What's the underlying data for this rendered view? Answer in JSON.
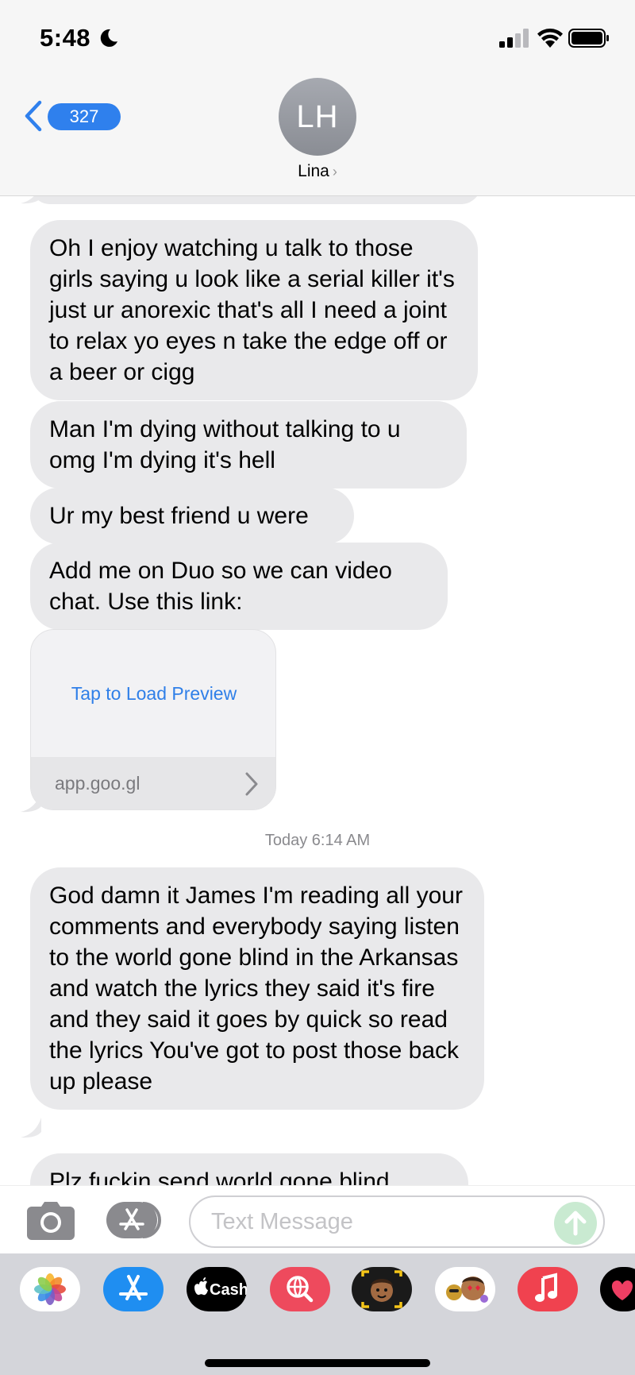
{
  "status_bar": {
    "time": "5:48"
  },
  "header": {
    "back_count": "327",
    "avatar_initials": "LH",
    "contact_name": "Lina"
  },
  "messages": [
    {
      "text": "Oh I enjoy watching u talk to those girls saying u look like a serial killer it's just ur anorexic that's all I need a joint to relax yo eyes n take the edge off or a beer or cigg"
    },
    {
      "text": "Man I'm dying without talking to u omg I'm dying it's hell"
    },
    {
      "text": "Ur my best friend u were"
    },
    {
      "text": "Add me on Duo so we can video chat. Use this link:"
    }
  ],
  "link_preview": {
    "action": "Tap to Load Preview",
    "url": "app.goo.gl"
  },
  "timestamp": "Today 6:14 AM",
  "later_messages": [
    {
      "text": "God damn it James I'm reading all your comments and everybody saying listen to the world gone blind in the Arkansas and watch the lyrics they said it's fire and they said it goes by quick so read the lyrics You've got to post those back up please"
    },
    {
      "text": "Plz fuckin send world gone blind"
    }
  ],
  "compose": {
    "placeholder": "Text Message"
  },
  "app_drawer": [
    {
      "name": "photos",
      "icon": "photos-icon"
    },
    {
      "name": "app-store",
      "icon": "app-store-icon"
    },
    {
      "name": "cash",
      "label": "Cash",
      "icon": "apple-cash-icon"
    },
    {
      "name": "images-search",
      "icon": "globe-search-icon"
    },
    {
      "name": "memoji-camera",
      "icon": "memoji-camera-icon"
    },
    {
      "name": "memoji-stickers",
      "icon": "memoji-stickers-icon"
    },
    {
      "name": "music",
      "icon": "music-note-icon"
    },
    {
      "name": "digital-touch",
      "icon": "heart-icon"
    }
  ],
  "colors": {
    "accent": "#2f80ed",
    "bubble_gray": "#e9e9eb",
    "link_blue": "#2f7fe8",
    "send_green": "#c9ead1"
  }
}
